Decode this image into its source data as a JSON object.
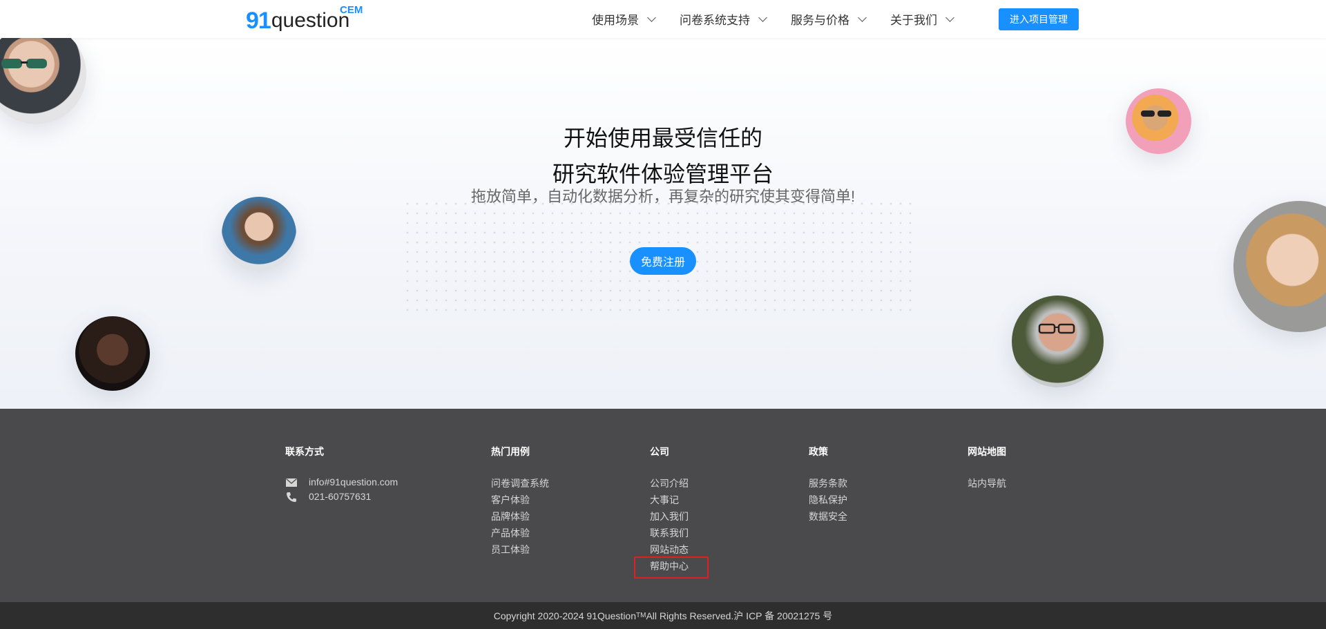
{
  "header": {
    "logo": {
      "num": "91",
      "word": "question",
      "sup": "CEM"
    },
    "nav": [
      {
        "label": "使用场景"
      },
      {
        "label": "问卷系统支持"
      },
      {
        "label": "服务与价格"
      },
      {
        "label": "关于我们"
      }
    ],
    "enter_button": "进入项目管理"
  },
  "hero": {
    "title_line1": "开始使用最受信任的",
    "title_line2": "研究软件体验管理平台",
    "subtitle": "拖放简单，自动化数据分析，再复杂的研究使其变得简单!",
    "signup_button": "免费注册"
  },
  "footer": {
    "contact": {
      "heading": "联系方式",
      "email": "info#91question.com",
      "phone": "021-60757631"
    },
    "cases": {
      "heading": "热门用例",
      "items": [
        "问卷调查系统",
        "客户体验",
        "品牌体验",
        "产品体验",
        "员工体验"
      ]
    },
    "company": {
      "heading": "公司",
      "items": [
        "公司介绍",
        "大事记",
        "加入我们",
        "联系我们",
        "网站动态",
        "帮助中心"
      ]
    },
    "policy": {
      "heading": "政策",
      "items": [
        "服务条款",
        "隐私保护",
        "数据安全"
      ]
    },
    "sitemap": {
      "heading": "网站地图",
      "items": [
        "站内导航"
      ]
    }
  },
  "copyright": {
    "before": "Copyright 2020-2024 91Question",
    "tm": "TM",
    "after": " All Rights Reserved.沪 ICP 备 20021275 号"
  },
  "colors": {
    "accent": "#1890ff",
    "footer_bg": "#4a4a4c",
    "copyright_bg": "#2e2e2f",
    "highlight": "#e02020"
  }
}
